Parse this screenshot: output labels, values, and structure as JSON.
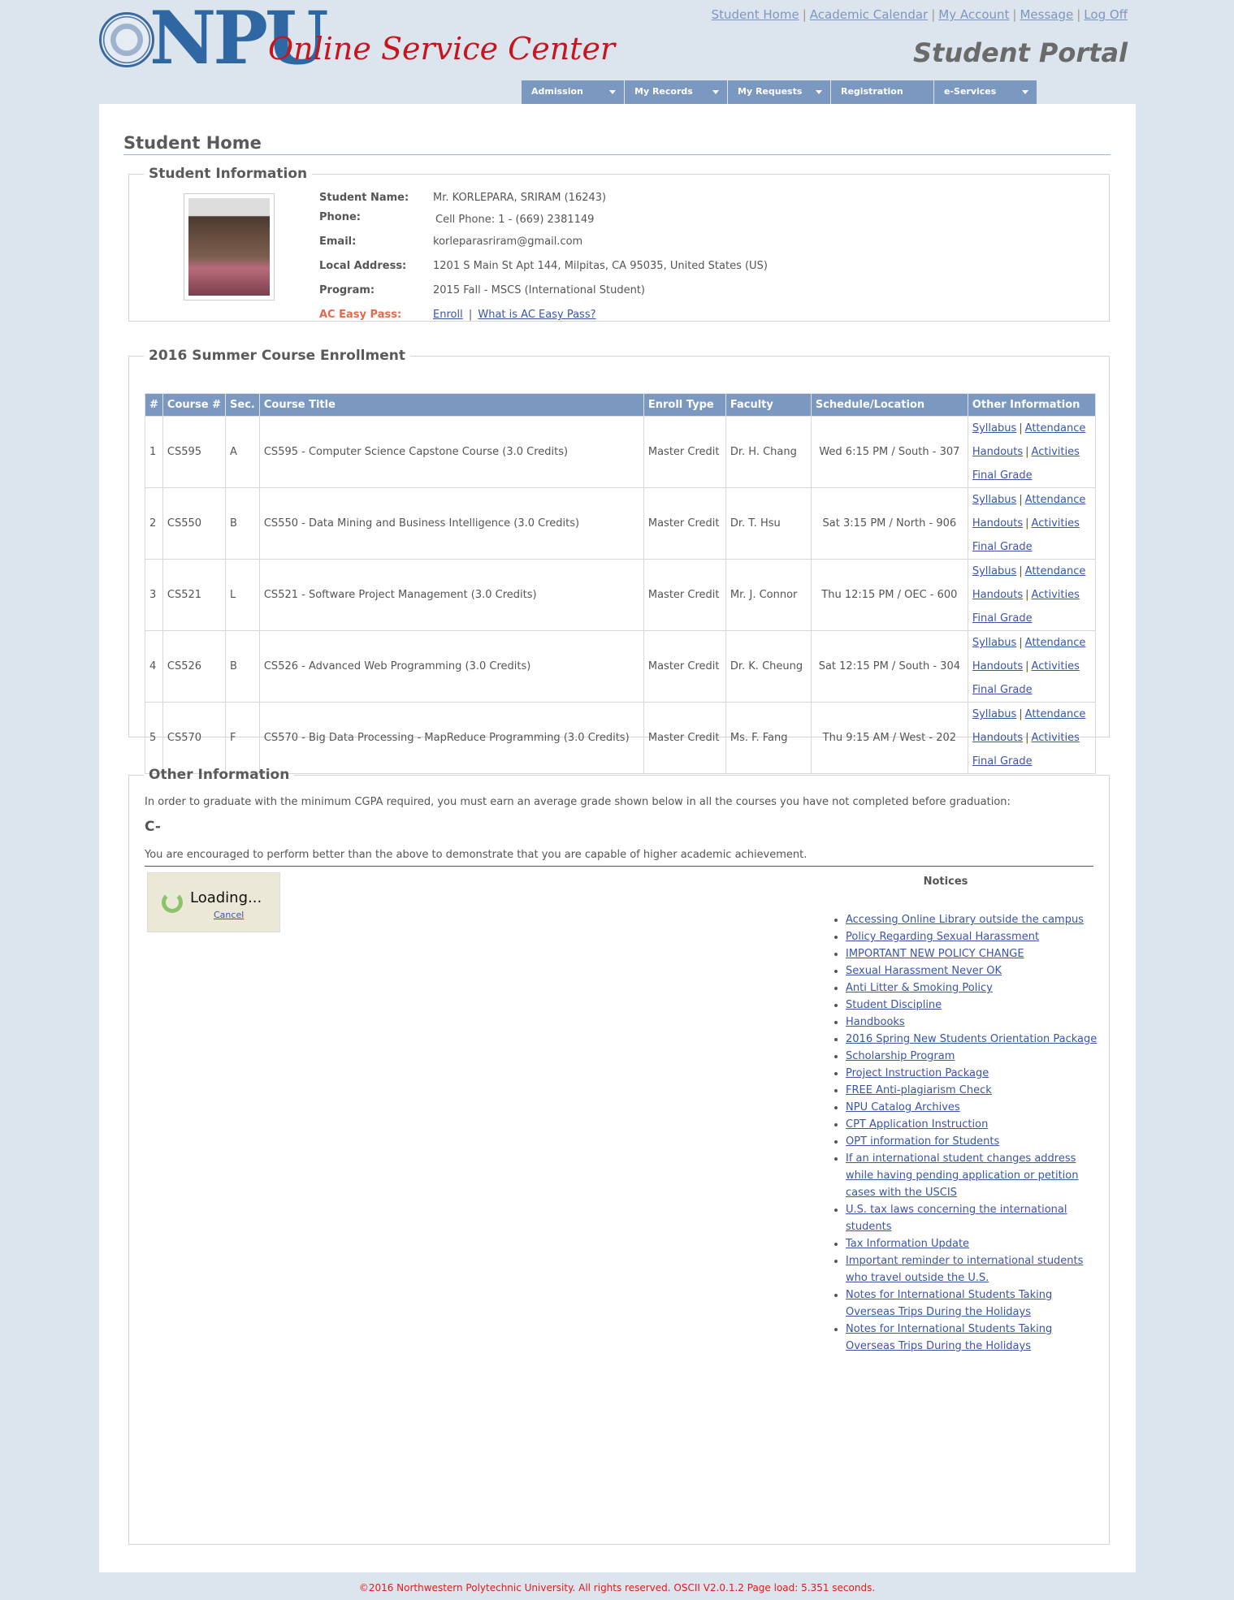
{
  "header": {
    "logo_npu": "NPU",
    "logo_subtitle": "Online Service Center",
    "portal_title": "Student Portal",
    "top_links": [
      "Student Home",
      "Academic Calendar",
      "My Account",
      "Message",
      "Log Off"
    ],
    "menu": [
      {
        "label": "Admission",
        "dropdown": true
      },
      {
        "label": "My Records",
        "dropdown": true
      },
      {
        "label": "My Requests",
        "dropdown": true
      },
      {
        "label": "Registration",
        "dropdown": false
      },
      {
        "label": "e-Services",
        "dropdown": true
      }
    ],
    "menu_color": "#7a98c0"
  },
  "page_title": "Student Home",
  "student_info": {
    "legend": "Student Information",
    "rows": [
      {
        "label": "Student Name:",
        "value": "Mr. KORLEPARA, SRIRAM (16243)"
      },
      {
        "label": "Phone:",
        "value": "Cell Phone: 1 - (669) 2381149"
      },
      {
        "label": "Email:",
        "value": "korleparasriram@gmail.com"
      },
      {
        "label": "Local Address:",
        "value": "1201 S Main St Apt 144, Milpitas, CA 95035, United States (US)"
      },
      {
        "label": "Program:",
        "value": "2015 Fall - MSCS (International Student)"
      }
    ],
    "easy_pass": {
      "label": "AC Easy Pass:",
      "links": [
        "Enroll",
        "What is AC Easy Pass?"
      ]
    }
  },
  "enrollment": {
    "legend": "2016 Summer Course Enrollment",
    "columns": [
      "#",
      "Course #",
      "Sec.",
      "Course Title",
      "Enroll Type",
      "Faculty",
      "Schedule/Location",
      "Other Information"
    ],
    "link_labels": {
      "syllabus": "Syllabus",
      "attendance": "Attendance",
      "handouts": "Handouts",
      "activities": "Activities",
      "final_grade": "Final Grade"
    },
    "rows": [
      {
        "num": "1",
        "course": "CS595",
        "sec": "A",
        "title": "CS595 - Computer Science Capstone Course (3.0 Credits)",
        "type": "Master Credit",
        "faculty": "Dr. H. Chang",
        "schedule": "Wed 6:15 PM / South - 307"
      },
      {
        "num": "2",
        "course": "CS550",
        "sec": "B",
        "title": "CS550 - Data Mining and Business Intelligence (3.0 Credits)",
        "type": "Master Credit",
        "faculty": "Dr. T. Hsu",
        "schedule": "Sat 3:15 PM / North - 906"
      },
      {
        "num": "3",
        "course": "CS521",
        "sec": "L",
        "title": "CS521 - Software Project Management (3.0 Credits)",
        "type": "Master Credit",
        "faculty": "Mr. J. Connor",
        "schedule": "Thu 12:15 PM / OEC - 600"
      },
      {
        "num": "4",
        "course": "CS526",
        "sec": "B",
        "title": "CS526 - Advanced Web Programming (3.0 Credits)",
        "type": "Master Credit",
        "faculty": "Dr. K. Cheung",
        "schedule": "Sat 12:15 PM / South - 304"
      },
      {
        "num": "5",
        "course": "CS570",
        "sec": "F",
        "title": "CS570 - Big Data Processing - MapReduce Programming (3.0 Credits)",
        "type": "Master Credit",
        "faculty": "Ms. F. Fang",
        "schedule": "Thu 9:15 AM / West - 202"
      }
    ]
  },
  "other_info": {
    "legend": "Other Information",
    "intro": "In order to graduate with the minimum CGPA required, you must earn an average grade shown below in all the courses you have not completed before graduation:",
    "grade": "C-",
    "encourage": "You are encouraged to perform better than the above to demonstrate that you are capable of higher academic achievement.",
    "loading": {
      "text": "Loading...",
      "cancel": "Cancel"
    },
    "notices_title": "Notices",
    "notices": [
      "Accessing Online Library outside the campus",
      "Policy Regarding Sexual Harassment",
      "IMPORTANT NEW POLICY CHANGE",
      "Sexual Harassment Never OK",
      "Anti Litter & Smoking Policy",
      "Student Discipline",
      "Handbooks",
      "2016 Spring New Students Orientation Package",
      "Scholarship Program",
      "Project Instruction Package",
      "FREE Anti-plagiarism Check",
      "NPU Catalog Archives",
      "CPT Application Instruction",
      "OPT information for Students",
      "If an international student changes address while having pending application or petition cases with the USCIS",
      "U.S. tax laws concerning the international students",
      "Tax Information Update",
      "Important reminder to international students who travel outside the U.S.",
      "Notes for International Students Taking Overseas Trips During the Holidays",
      "Notes for International Students Taking Overseas Trips During the Holidays"
    ]
  },
  "footer": "©2016 Northwestern Polytechnic University. All rights reserved. OSCII V2.0.1.2 Page load: 5.351 seconds."
}
